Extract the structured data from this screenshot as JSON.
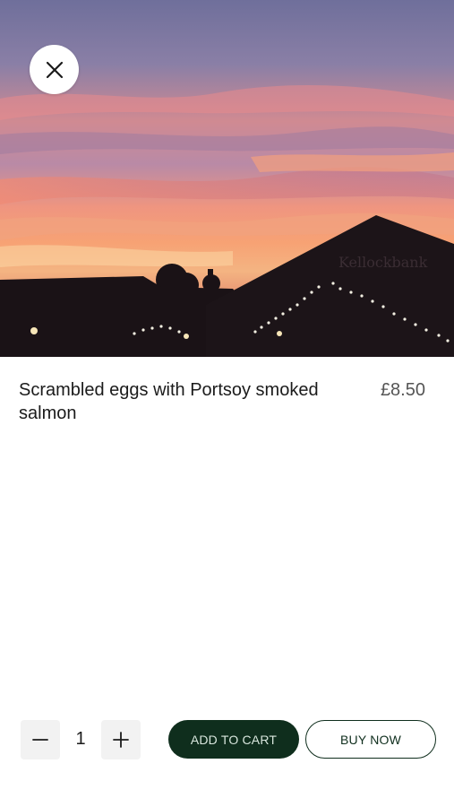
{
  "hero": {
    "image_description_icon": "product-photo",
    "sign_text": "Kellockbank"
  },
  "close_icon": "close-icon",
  "product": {
    "name": "Scrambled eggs with Portsoy smoked salmon",
    "price": "£8.50"
  },
  "quantity": {
    "value": "1",
    "decrement_icon": "minus-icon",
    "increment_icon": "plus-icon"
  },
  "actions": {
    "add_to_cart": "ADD TO CART",
    "buy_now": "BUY NOW"
  },
  "colors": {
    "brand_dark_green": "#0f2e1d",
    "qty_background": "#f2f2f2",
    "price_text": "#555555"
  }
}
